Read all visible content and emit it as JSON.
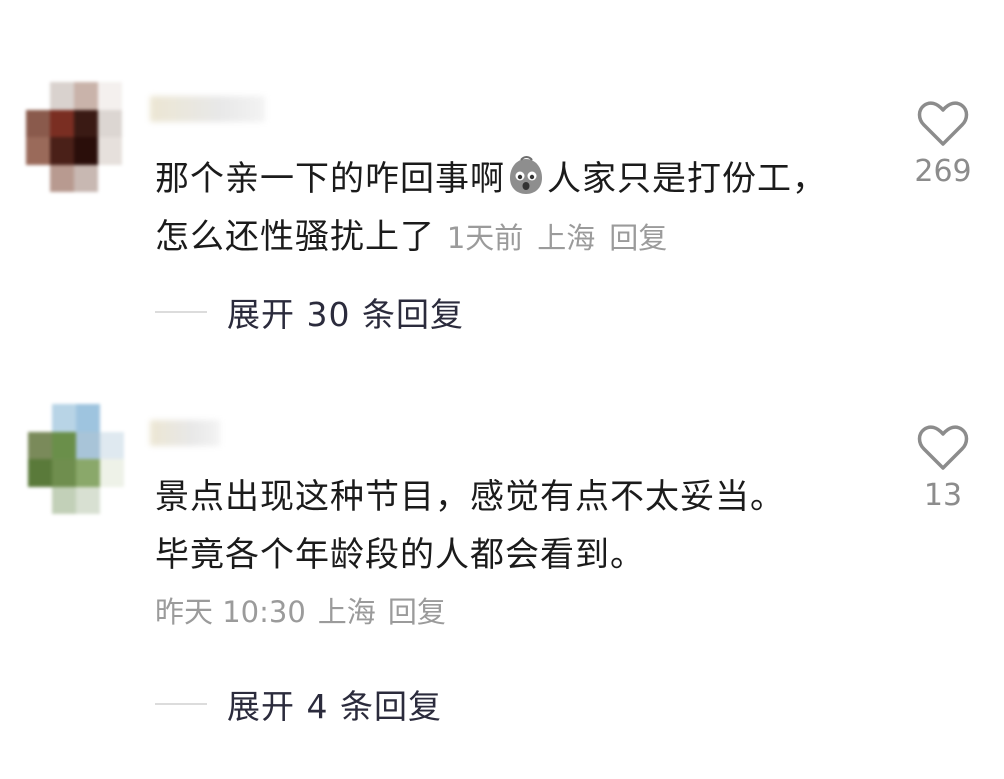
{
  "comments": [
    {
      "avatar_colors": [
        "#ffffff",
        "#d9d2ce",
        "#c9b3aa",
        "#f4f0ee",
        "#8a5a4c",
        "#7a2e22",
        "#3a1a14",
        "#dcd6d2",
        "#9a6a5a",
        "#4a2018",
        "#2a0e0a",
        "#e6e0dc",
        "#ffffff",
        "#b89a90",
        "#c8b8b2",
        "#ffffff"
      ],
      "text_before_emoji": "那个亲一下的咋回事啊",
      "emoji": "crying-face-emoji",
      "text_after_emoji": "人家只是打份工，怎么还性骚扰上了",
      "time": "1天前",
      "location": "上海",
      "reply": "回复",
      "like_count": "269",
      "expand": "展开 30 条回复"
    },
    {
      "avatar_colors": [
        "#ffffff",
        "#b8d4e6",
        "#9ec4df",
        "#ffffff",
        "#7a8a5a",
        "#6a8f4a",
        "#a8c4d8",
        "#dfe9f0",
        "#5a7a3a",
        "#6f8e4e",
        "#8aa86a",
        "#eef2e8",
        "#ffffff",
        "#c2d0b8",
        "#d8e0d2",
        "#ffffff"
      ],
      "text": "景点出现这种节目，感觉有点不太妥当。毕竟各个年龄段的人都会看到。",
      "time": "昨天 10:30",
      "location": "上海",
      "reply": "回复",
      "like_count": "13",
      "expand": "展开 4 条回复"
    }
  ],
  "colors": {
    "text": "#1b1b1b",
    "meta": "#9b9b9b",
    "heart": "#8c8c8c",
    "expand": "#2b2b3c"
  }
}
